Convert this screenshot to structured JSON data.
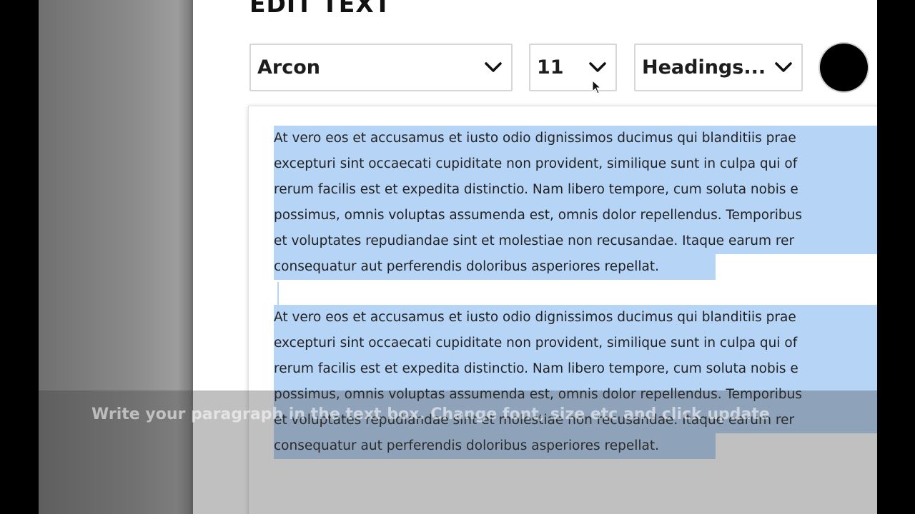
{
  "dialog": {
    "title": "EDIT TEXT"
  },
  "toolbar": {
    "font": {
      "value": "Arcon",
      "icon": "chevron-down-icon"
    },
    "size": {
      "value": "11",
      "icon": "chevron-down-icon"
    },
    "style": {
      "value": "Headings...",
      "icon": "chevron-down-icon"
    },
    "color": {
      "value": "#000000"
    }
  },
  "editor": {
    "paragraphs": [
      {
        "lines": [
          "At vero eos et accusamus et iusto odio dignissimos ducimus qui blanditiis prae",
          "excepturi sint occaecati cupiditate non provident, similique sunt in culpa qui of",
          "rerum facilis est et expedita distinctio. Nam libero tempore, cum soluta nobis e",
          "possimus, omnis voluptas assumenda est, omnis dolor repellendus. Temporibus",
          "et voluptates repudiandae sint et molestiae non recusandae. Itaque earum rer",
          "consequatur aut perferendis doloribus asperiores repellat."
        ]
      },
      {
        "lines": [
          "At vero eos et accusamus et iusto odio dignissimos ducimus qui blanditiis prae",
          "excepturi sint occaecati cupiditate non provident, similique sunt in culpa qui of",
          "rerum facilis est et expedita distinctio. Nam libero tempore, cum soluta nobis e",
          "possimus, omnis voluptas assumenda est, omnis dolor repellendus. Temporibus",
          "et voluptates repudiandae sint et molestiae non recusandae. Itaque earum rer",
          "consequatur aut perferendis doloribus asperiores repellat."
        ]
      }
    ],
    "selection_color": "#b5d4f6"
  },
  "caption": {
    "text": "Write your paragraph in the text box. Change font, size etc and click update"
  }
}
